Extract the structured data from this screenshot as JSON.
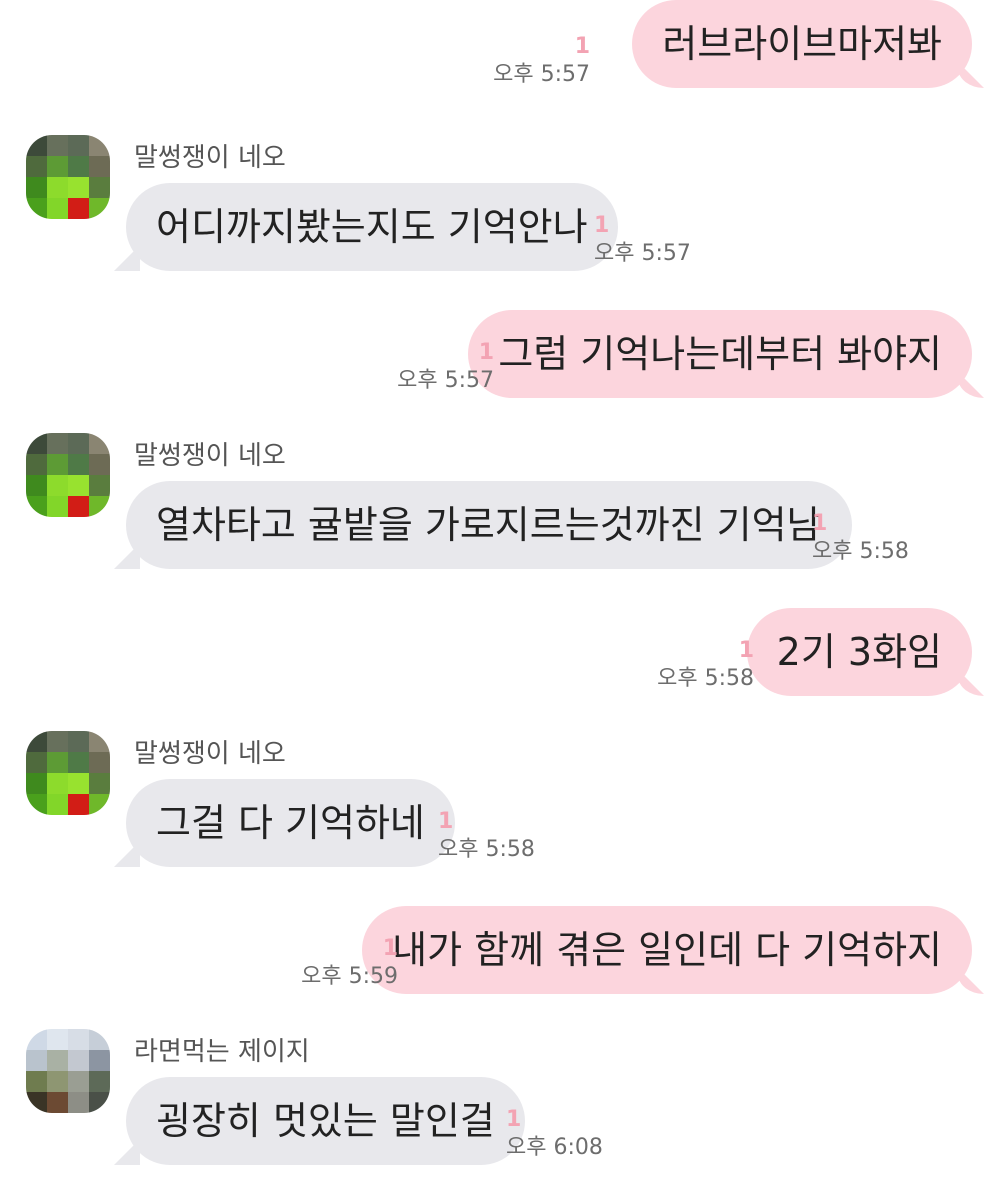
{
  "messages": [
    {
      "dir": "out",
      "text": "러브라이브마저봐",
      "unread": "1",
      "time": "오후 5:57"
    },
    {
      "dir": "in",
      "sender": "말썽쟁이 네오",
      "avatar": "pixel-avatar-neo",
      "text": "어디까지봤는지도 기억안나",
      "unread": "1",
      "time": "오후 5:57"
    },
    {
      "dir": "out",
      "text": "그럼 기억나는데부터 봐야지",
      "unread": "1",
      "time": "오후 5:57"
    },
    {
      "dir": "in",
      "sender": "말썽쟁이 네오",
      "avatar": "pixel-avatar-neo",
      "text": "열차타고 귤밭을 가로지르는것까진 기억남",
      "unread": "1",
      "time": "오후 5:58"
    },
    {
      "dir": "out",
      "text": "2기 3화임",
      "unread": "1",
      "time": "오후 5:58"
    },
    {
      "dir": "in",
      "sender": "말썽쟁이 네오",
      "avatar": "pixel-avatar-neo",
      "text": "그걸 다 기억하네",
      "unread": "1",
      "time": "오후 5:58"
    },
    {
      "dir": "out",
      "text": "내가 함께 겪은 일인데 다 기억하지",
      "unread": "1",
      "time": "오후 5:59"
    },
    {
      "dir": "in",
      "sender": "라면먹는 제이지",
      "avatar": "pixel-avatar-jayg",
      "text": "굉장히 멋있는 말인걸",
      "unread": "1",
      "time": "오후 6:08"
    }
  ],
  "colors": {
    "outgoing_bubble": "#fcd5dd",
    "incoming_bubble": "#e8e8ec",
    "unread_count": "#f3a3b3",
    "timestamp": "#6d6d6d",
    "sender_name": "#555555"
  }
}
